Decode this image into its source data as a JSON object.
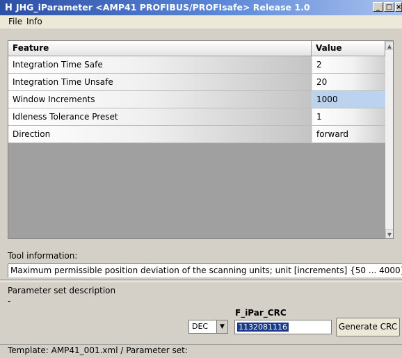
{
  "window": {
    "icon": "H",
    "title": "JHG_iParameter  <AMP41 PROFIBUS/PROFIsafe> Release 1.0",
    "minimize": "_",
    "maximize": "□",
    "close": "×"
  },
  "menu": {
    "items": [
      "File",
      "Info"
    ]
  },
  "grid": {
    "headers": {
      "feature": "Feature",
      "value": "Value"
    },
    "rows": [
      {
        "feature": "Integration Time Safe",
        "value": "2"
      },
      {
        "feature": "Integration Time Unsafe",
        "value": "20"
      },
      {
        "feature": "Window Increments",
        "value": "1000"
      },
      {
        "feature": "Idleness Tolerance Preset",
        "value": "1"
      },
      {
        "feature": "Direction",
        "value": "forward"
      }
    ],
    "selected_row": 2,
    "scroll_up": "▲",
    "scroll_down": "▼"
  },
  "tool_info": {
    "label": "Tool information:",
    "text": "Maximum permissible position deviation of the scanning units; unit [increments] {50 ... 4000}"
  },
  "param_desc": {
    "label": "Parameter set description",
    "value": "-"
  },
  "crc": {
    "label": "F_iPar_CRC",
    "format_selected": "DEC",
    "dropdown_arrow": "▼",
    "value": "1132081116",
    "button": "Generate CRC"
  },
  "status": {
    "text": "Template: AMP41_001.xml  / Parameter set:"
  }
}
